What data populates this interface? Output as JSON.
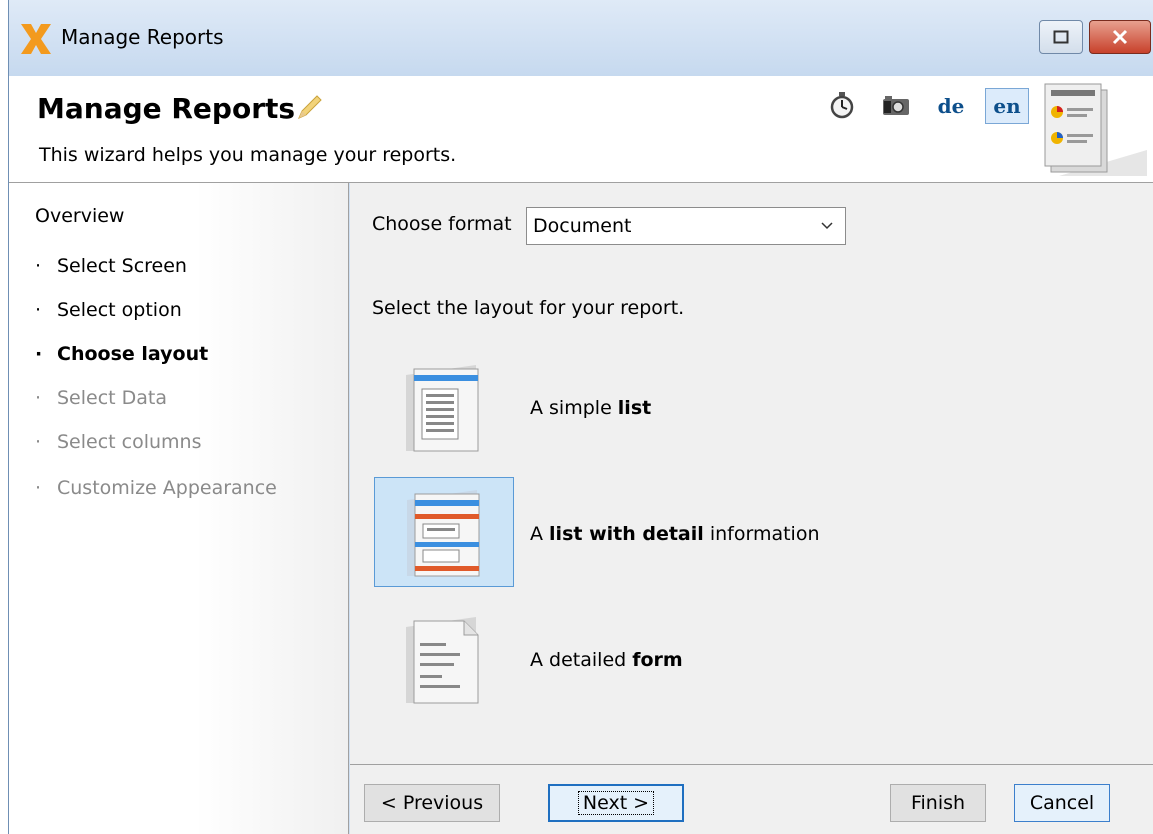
{
  "window": {
    "title": "Manage Reports"
  },
  "header": {
    "title": "Manage Reports",
    "subtitle": "This wizard helps you manage your reports.",
    "languages": [
      "de",
      "en"
    ],
    "active_language": "en"
  },
  "sidebar": {
    "overview": "Overview",
    "items": [
      {
        "label": "Select Screen",
        "state": "done"
      },
      {
        "label": "Select option",
        "state": "done"
      },
      {
        "label": "Choose layout",
        "state": "current"
      },
      {
        "label": "Select Data",
        "state": "todo"
      },
      {
        "label": "Select columns",
        "state": "todo"
      },
      {
        "label": "Customize Appearance",
        "state": "todo"
      }
    ]
  },
  "main": {
    "format_label": "Choose format",
    "format_value": "Document",
    "layout_prompt": "Select the layout for your report.",
    "options": [
      {
        "pre": "A simple ",
        "bold": "list",
        "post": "",
        "selected": false
      },
      {
        "pre": "A ",
        "bold": "list with detail",
        "post": " information",
        "selected": true
      },
      {
        "pre": "A detailed ",
        "bold": "form",
        "post": "",
        "selected": false
      }
    ]
  },
  "buttons": {
    "previous": "< Previous",
    "next": "Next >",
    "finish": "Finish",
    "cancel": "Cancel"
  },
  "icons": {
    "app": "x-logo-icon",
    "edit": "pencil-icon",
    "timer": "stopwatch-icon",
    "camera": "camera-icon"
  },
  "colors": {
    "title_bar": "#c6d9ef",
    "selection": "#cce4f7",
    "language_link": "#0d4f8b",
    "close_button": "#c8412b"
  }
}
